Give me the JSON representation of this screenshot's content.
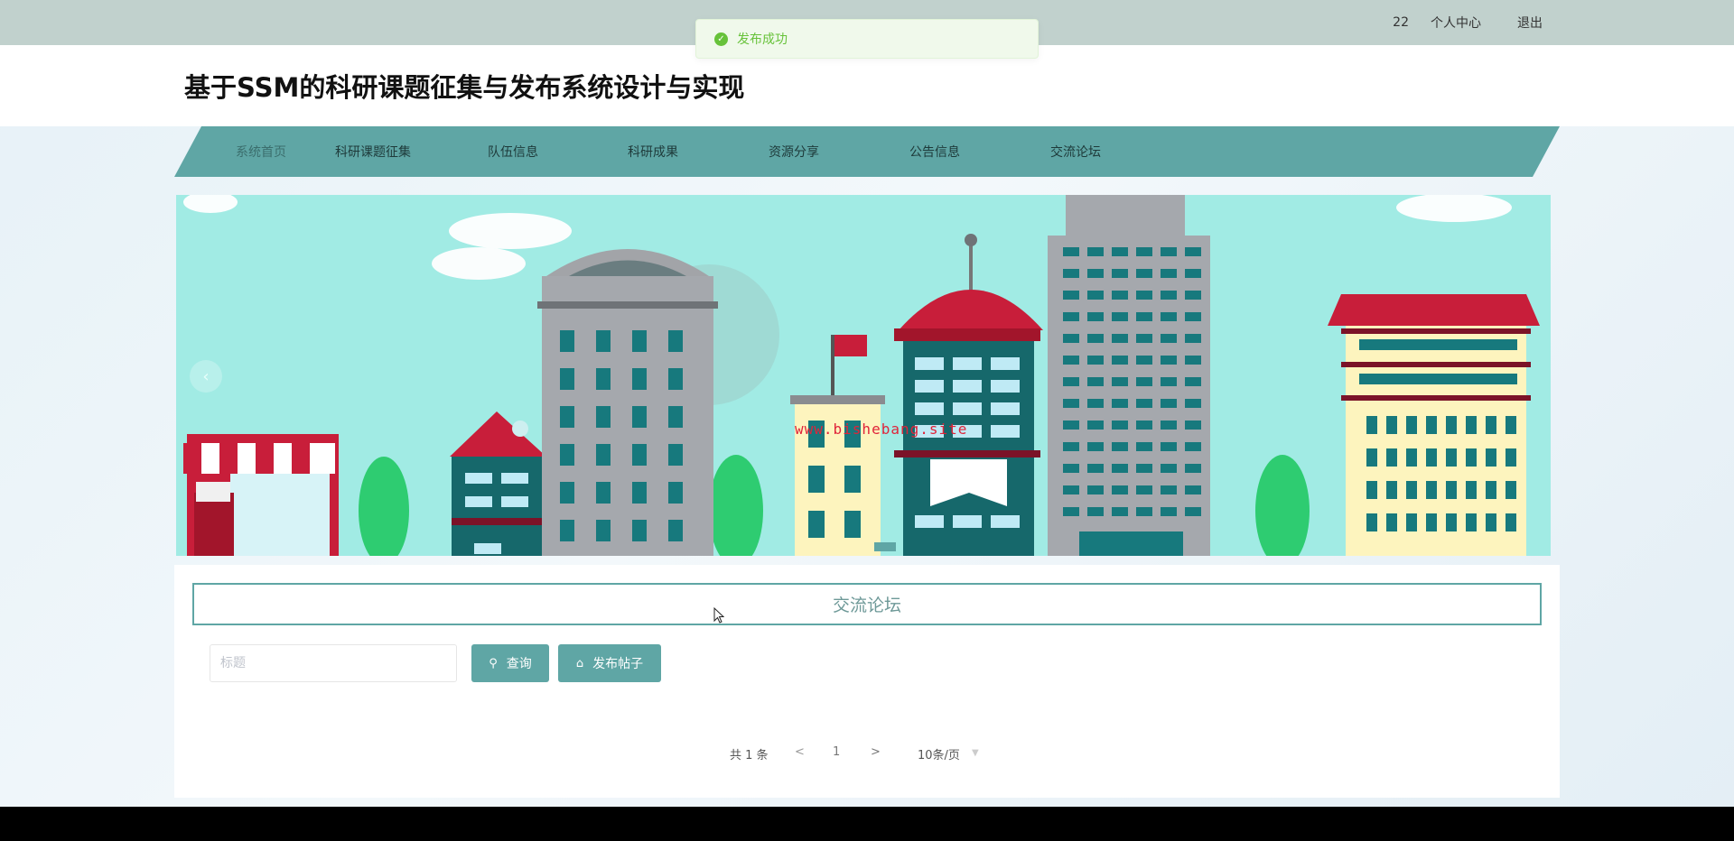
{
  "topbar": {
    "username": "22",
    "profile_label": "个人中心",
    "logout_label": "退出"
  },
  "toast": {
    "message": "发布成功"
  },
  "header": {
    "title": "基于SSM的科研课题征集与发布系统设计与实现"
  },
  "nav": {
    "items": [
      {
        "label": "系统首页"
      },
      {
        "label": "科研课题征集"
      },
      {
        "label": "队伍信息"
      },
      {
        "label": "科研成果"
      },
      {
        "label": "资源分享"
      },
      {
        "label": "公告信息"
      },
      {
        "label": "交流论坛"
      }
    ]
  },
  "banner": {
    "watermark": "www.bishebang.site",
    "prev_icon": "chevron-left-icon"
  },
  "forum": {
    "section_title": "交流论坛",
    "search_placeholder": "标题",
    "search_label": "查询",
    "search_icon": "search-icon",
    "publish_label": "发布帖子",
    "publish_icon": "home-icon"
  },
  "pagination": {
    "total": "共 1 条",
    "prev": "<",
    "current_page": "1",
    "next": ">",
    "page_size": "10条/页"
  },
  "colors": {
    "primary": "#5fa6a5",
    "topbar": "#c1d1cd",
    "toast_success": "#67c23a"
  }
}
